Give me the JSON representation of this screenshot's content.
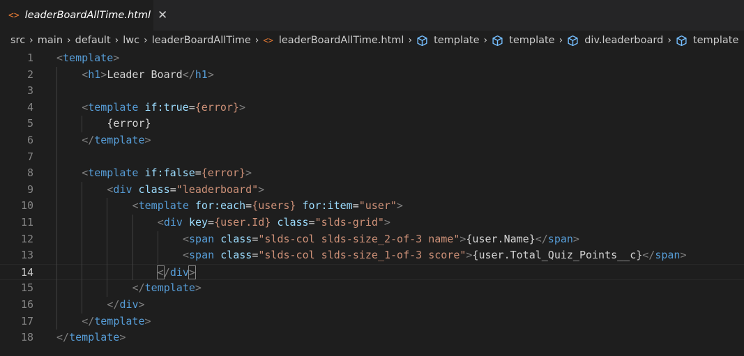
{
  "tab": {
    "icon": "html-file-icon",
    "title": "leaderBoardAllTime.html",
    "close": "✕"
  },
  "breadcrumb": [
    {
      "label": "src",
      "icon": null
    },
    {
      "label": "main",
      "icon": null
    },
    {
      "label": "default",
      "icon": null
    },
    {
      "label": "lwc",
      "icon": null
    },
    {
      "label": "leaderBoardAllTime",
      "icon": null
    },
    {
      "label": "leaderBoardAllTime.html",
      "icon": "html-icon"
    },
    {
      "label": "template",
      "icon": "cube-icon"
    },
    {
      "label": "template",
      "icon": "cube-icon"
    },
    {
      "label": "div.leaderboard",
      "icon": "cube-icon"
    },
    {
      "label": "template",
      "icon": "cube-icon"
    }
  ],
  "colors": {
    "tag": "#569cd6",
    "bracket": "#808080",
    "attr": "#9cdcfe",
    "string": "#ce9178",
    "text": "#d4d4d4",
    "line_number": "#858585"
  },
  "code": {
    "current_line": 14,
    "lines": [
      {
        "n": "1",
        "i": 0,
        "t": [
          [
            "br",
            "<"
          ],
          [
            "tag",
            "template"
          ],
          [
            "br",
            ">"
          ]
        ]
      },
      {
        "n": "2",
        "i": 1,
        "t": [
          [
            "br",
            "<"
          ],
          [
            "tag",
            "h1"
          ],
          [
            "br",
            ">"
          ],
          [
            "txt",
            "Leader Board"
          ],
          [
            "br",
            "</"
          ],
          [
            "tag",
            "h1"
          ],
          [
            "br",
            ">"
          ]
        ]
      },
      {
        "n": "3",
        "i": 0,
        "t": []
      },
      {
        "n": "4",
        "i": 1,
        "t": [
          [
            "br",
            "<"
          ],
          [
            "tag",
            "template"
          ],
          [
            "txt",
            " "
          ],
          [
            "attr",
            "if:true"
          ],
          [
            "txt",
            "="
          ],
          [
            "str",
            "{error}"
          ],
          [
            "br",
            ">"
          ]
        ]
      },
      {
        "n": "5",
        "i": 2,
        "t": [
          [
            "txt",
            "{error}"
          ]
        ]
      },
      {
        "n": "6",
        "i": 1,
        "t": [
          [
            "br",
            "</"
          ],
          [
            "tag",
            "template"
          ],
          [
            "br",
            ">"
          ]
        ]
      },
      {
        "n": "7",
        "i": 0,
        "t": []
      },
      {
        "n": "8",
        "i": 1,
        "t": [
          [
            "br",
            "<"
          ],
          [
            "tag",
            "template"
          ],
          [
            "txt",
            " "
          ],
          [
            "attr",
            "if:false"
          ],
          [
            "txt",
            "="
          ],
          [
            "str",
            "{error}"
          ],
          [
            "br",
            ">"
          ]
        ]
      },
      {
        "n": "9",
        "i": 2,
        "t": [
          [
            "br",
            "<"
          ],
          [
            "tag",
            "div"
          ],
          [
            "txt",
            " "
          ],
          [
            "attr",
            "class"
          ],
          [
            "txt",
            "="
          ],
          [
            "str",
            "\"leaderboard\""
          ],
          [
            "br",
            ">"
          ]
        ]
      },
      {
        "n": "10",
        "i": 3,
        "t": [
          [
            "br",
            "<"
          ],
          [
            "tag",
            "template"
          ],
          [
            "txt",
            " "
          ],
          [
            "attr",
            "for:each"
          ],
          [
            "txt",
            "="
          ],
          [
            "str",
            "{users}"
          ],
          [
            "txt",
            " "
          ],
          [
            "attr",
            "for:item"
          ],
          [
            "txt",
            "="
          ],
          [
            "str",
            "\"user\""
          ],
          [
            "br",
            ">"
          ]
        ]
      },
      {
        "n": "11",
        "i": 4,
        "t": [
          [
            "br",
            "<"
          ],
          [
            "tag",
            "div"
          ],
          [
            "txt",
            " "
          ],
          [
            "attr",
            "key"
          ],
          [
            "txt",
            "="
          ],
          [
            "str",
            "{user.Id}"
          ],
          [
            "txt",
            " "
          ],
          [
            "attr",
            "class"
          ],
          [
            "txt",
            "="
          ],
          [
            "str",
            "\"slds-grid\""
          ],
          [
            "br",
            ">"
          ]
        ]
      },
      {
        "n": "12",
        "i": 5,
        "t": [
          [
            "br",
            "<"
          ],
          [
            "tag",
            "span"
          ],
          [
            "txt",
            " "
          ],
          [
            "attr",
            "class"
          ],
          [
            "txt",
            "="
          ],
          [
            "str",
            "\"slds-col slds-size_2-of-3 name\""
          ],
          [
            "br",
            ">"
          ],
          [
            "txt",
            "{user.Name}"
          ],
          [
            "br",
            "</"
          ],
          [
            "tag",
            "span"
          ],
          [
            "br",
            ">"
          ]
        ]
      },
      {
        "n": "13",
        "i": 5,
        "t": [
          [
            "br",
            "<"
          ],
          [
            "tag",
            "span"
          ],
          [
            "txt",
            " "
          ],
          [
            "attr",
            "class"
          ],
          [
            "txt",
            "="
          ],
          [
            "str",
            "\"slds-col slds-size_1-of-3 score\""
          ],
          [
            "br",
            ">"
          ],
          [
            "txt",
            "{user.Total_Quiz_Points__c}"
          ],
          [
            "br",
            "</"
          ],
          [
            "tag",
            "span"
          ],
          [
            "br",
            ">"
          ]
        ]
      },
      {
        "n": "14",
        "i": 4,
        "t": [
          [
            "brhl",
            "<"
          ],
          [
            "br",
            "/"
          ],
          [
            "tag",
            "div"
          ],
          [
            "brhl",
            ">"
          ]
        ]
      },
      {
        "n": "15",
        "i": 3,
        "t": [
          [
            "br",
            "</"
          ],
          [
            "tag",
            "template"
          ],
          [
            "br",
            ">"
          ]
        ]
      },
      {
        "n": "16",
        "i": 2,
        "t": [
          [
            "br",
            "</"
          ],
          [
            "tag",
            "div"
          ],
          [
            "br",
            ">"
          ]
        ]
      },
      {
        "n": "17",
        "i": 1,
        "t": [
          [
            "br",
            "</"
          ],
          [
            "tag",
            "template"
          ],
          [
            "br",
            ">"
          ]
        ]
      },
      {
        "n": "18",
        "i": 0,
        "t": [
          [
            "br",
            "</"
          ],
          [
            "tag",
            "template"
          ],
          [
            "br",
            ">"
          ]
        ]
      }
    ]
  }
}
